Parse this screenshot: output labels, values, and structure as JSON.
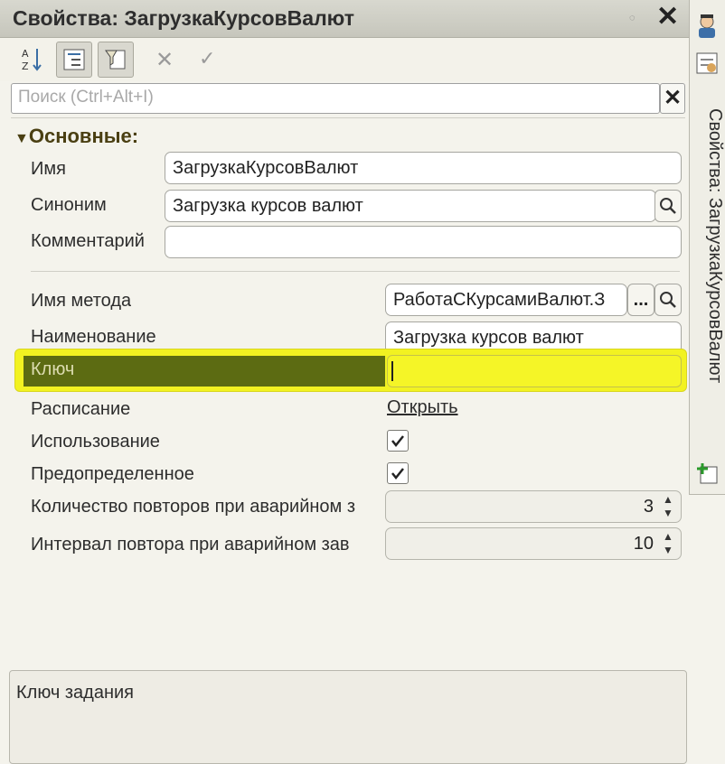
{
  "window": {
    "title": "Свойства: ЗагрузкаКурсовВалют"
  },
  "search": {
    "placeholder": "Поиск (Ctrl+Alt+I)"
  },
  "section": {
    "title": "Основные:"
  },
  "fields": {
    "name_label": "Имя",
    "name_value": "ЗагрузкаКурсовВалют",
    "synonym_label": "Синоним",
    "synonym_value": "Загрузка курсов валют",
    "comment_label": "Комментарий",
    "comment_value": "",
    "method_label": "Имя метода",
    "method_value": "РаботаСКурсамиВалют.З",
    "description_label": "Наименование",
    "description_value": "Загрузка курсов валют",
    "key_label": "Ключ",
    "key_value": "",
    "schedule_label": "Расписание",
    "schedule_link": "Открыть",
    "usage_label": "Использование",
    "predefined_label": "Предопределенное",
    "retry_count_label": "Количество повторов при аварийном з",
    "retry_count_value": "3",
    "retry_interval_label": "Интервал повтора при аварийном зав",
    "retry_interval_value": "10",
    "select_button_label": "..."
  },
  "description_panel": {
    "text": "Ключ задания"
  },
  "sidebar": {
    "tab_label": "Свойства: ЗагрузкаКурсовВалют"
  }
}
